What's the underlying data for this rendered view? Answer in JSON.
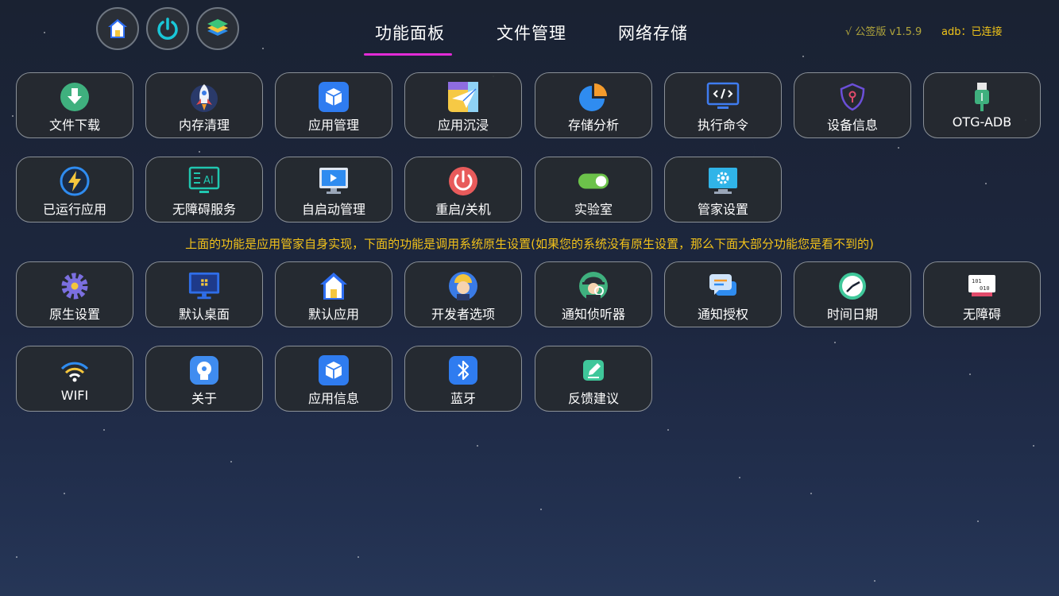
{
  "header": {
    "round_buttons": [
      {
        "icon": "home-icon"
      },
      {
        "icon": "power-icon"
      },
      {
        "icon": "layers-icon"
      }
    ],
    "tabs": [
      {
        "label": "功能面板",
        "active": true
      },
      {
        "label": "文件管理",
        "active": false
      },
      {
        "label": "网络存储",
        "active": false
      }
    ],
    "version": "√ 公签版 v1.5.9",
    "adb_status": "adb：已连接",
    "accent_color": "#e22bd6"
  },
  "notice": "上面的功能是应用管家自身实现，下面的功能是调用系统原生设置(如果您的系统没有原生设置，那么下面大部分功能您是看不到的)",
  "builtin_tiles": [
    {
      "label": "文件下载",
      "icon": "download-icon"
    },
    {
      "label": "内存清理",
      "icon": "rocket-icon"
    },
    {
      "label": "应用管理",
      "icon": "package-box-icon"
    },
    {
      "label": "应用沉浸",
      "icon": "paper-plane-icon"
    },
    {
      "label": "存储分析",
      "icon": "pie-chart-icon"
    },
    {
      "label": "执行命令",
      "icon": "code-monitor-icon"
    },
    {
      "label": "设备信息",
      "icon": "shield-icon"
    },
    {
      "label": "OTG-ADB",
      "icon": "usb-icon"
    },
    {
      "label": "已运行应用",
      "icon": "lightning-icon"
    },
    {
      "label": "无障碍服务",
      "icon": "ai-monitor-icon"
    },
    {
      "label": "自启动管理",
      "icon": "startup-monitor-icon"
    },
    {
      "label": "重启/关机",
      "icon": "power-icon"
    },
    {
      "label": "实验室",
      "icon": "toggle-icon"
    },
    {
      "label": "管家设置",
      "icon": "settings-monitor-icon"
    }
  ],
  "system_tiles": [
    {
      "label": "原生设置",
      "icon": "gear-icon"
    },
    {
      "label": "默认桌面",
      "icon": "desktop-icon"
    },
    {
      "label": "默认应用",
      "icon": "home-icon"
    },
    {
      "label": "开发者选项",
      "icon": "developer-icon"
    },
    {
      "label": "通知侦听器",
      "icon": "spy-icon"
    },
    {
      "label": "通知授权",
      "icon": "chat-icon"
    },
    {
      "label": "时间日期",
      "icon": "clock-icon"
    },
    {
      "label": "无障碍",
      "icon": "binary-monitor-icon"
    },
    {
      "label": "WIFI",
      "icon": "wifi-icon"
    },
    {
      "label": "关于",
      "icon": "info-badge-icon"
    },
    {
      "label": "应用信息",
      "icon": "package-box-icon"
    },
    {
      "label": "蓝牙",
      "icon": "bluetooth-icon"
    },
    {
      "label": "反馈建议",
      "icon": "edit-icon"
    }
  ]
}
